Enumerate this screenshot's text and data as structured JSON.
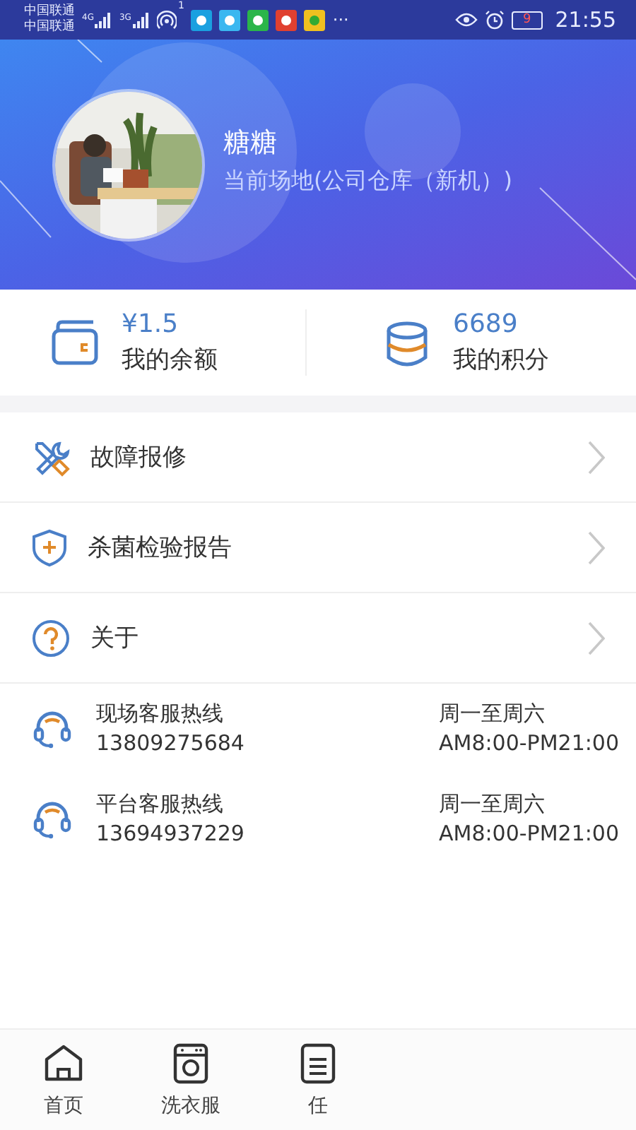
{
  "status_bar": {
    "carriers": [
      "中国联通",
      "中国联通"
    ],
    "networks": [
      {
        "label": "4G"
      },
      {
        "label": "3G"
      }
    ],
    "hotspot_badge": "1",
    "more": "···",
    "battery": "9",
    "time": "21:55"
  },
  "profile": {
    "name": "糖糖",
    "venue": "当前场地(公司仓库（新机）)"
  },
  "stats": [
    {
      "kind": "wallet",
      "value": "¥1.5",
      "label": "我的余额"
    },
    {
      "kind": "points",
      "value": "6689",
      "label": "我的积分"
    }
  ],
  "menu": [
    {
      "kind": "repair",
      "label": "故障报修"
    },
    {
      "kind": "report",
      "label": "杀菌检验报告"
    },
    {
      "kind": "about",
      "label": "关于"
    }
  ],
  "hotlines": [
    {
      "title": "现场客服热线",
      "phone": "13809275684",
      "days": "周一至周六",
      "hours": "AM8:00-PM21:00"
    },
    {
      "title": "平台客服热线",
      "phone": "13694937229",
      "days": "周一至周六",
      "hours": "AM8:00-PM21:00"
    }
  ],
  "tabs": [
    {
      "kind": "home",
      "label": "首页"
    },
    {
      "kind": "laundry",
      "label": "洗衣服"
    },
    {
      "kind": "task",
      "label": "任"
    }
  ]
}
